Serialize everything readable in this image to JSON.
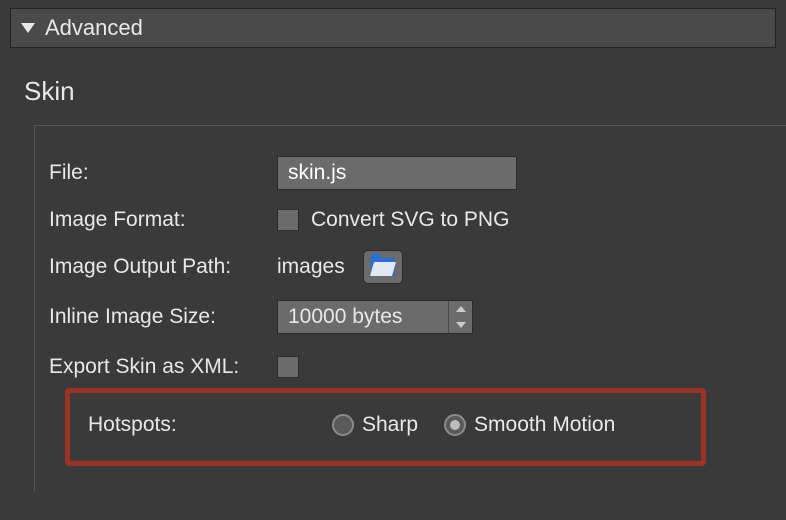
{
  "section": {
    "title": "Advanced"
  },
  "group": {
    "title": "Skin"
  },
  "fields": {
    "file": {
      "label": "File:",
      "value": "skin.js"
    },
    "imageFormat": {
      "label": "Image Format:",
      "option": "Convert SVG to PNG"
    },
    "imageOutputPath": {
      "label": "Image Output Path:",
      "value": "images"
    },
    "inlineImageSize": {
      "label": "Inline Image Size:",
      "value": "10000 bytes"
    },
    "exportXml": {
      "label": "Export Skin as XML:"
    },
    "hotspots": {
      "label": "Hotspots:",
      "options": {
        "sharp": "Sharp",
        "smooth": "Smooth Motion"
      }
    }
  }
}
